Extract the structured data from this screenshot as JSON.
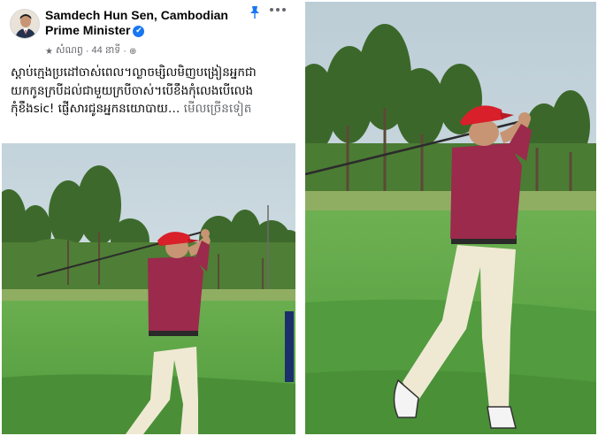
{
  "post": {
    "author": "Samdech Hun Sen, Cambodian Prime Minister",
    "verified_icon": "✔",
    "meta_label": "សំណព្វ",
    "time": "44 នាទី",
    "text": "ស្តាប់ក្មេងប្រដៅចាស់ពេល។ល្ងាចម្សិលមិញបង្រៀនអ្នកជាយកកូនក្របីដល់ជាមួយក្របីចាស់។បើខឹងកុំលេងបើលេងកុំខឹងsic! ផ្ញើសារជូនអ្នកនយោបាយ…",
    "see_more": "មើលច្រើនទៀត",
    "icons": {
      "pin": "pin-icon",
      "more": "more-options-icon",
      "star": "star-icon",
      "globe": "globe-icon",
      "verified": "verified-badge-icon"
    }
  },
  "colors": {
    "brand_blue": "#1877f2",
    "text": "#050505",
    "meta": "#65676b",
    "shirt": "#9b2a4c",
    "cap": "#d81f2a",
    "grass": "#5ea445",
    "sky": "#cfdbe1"
  }
}
